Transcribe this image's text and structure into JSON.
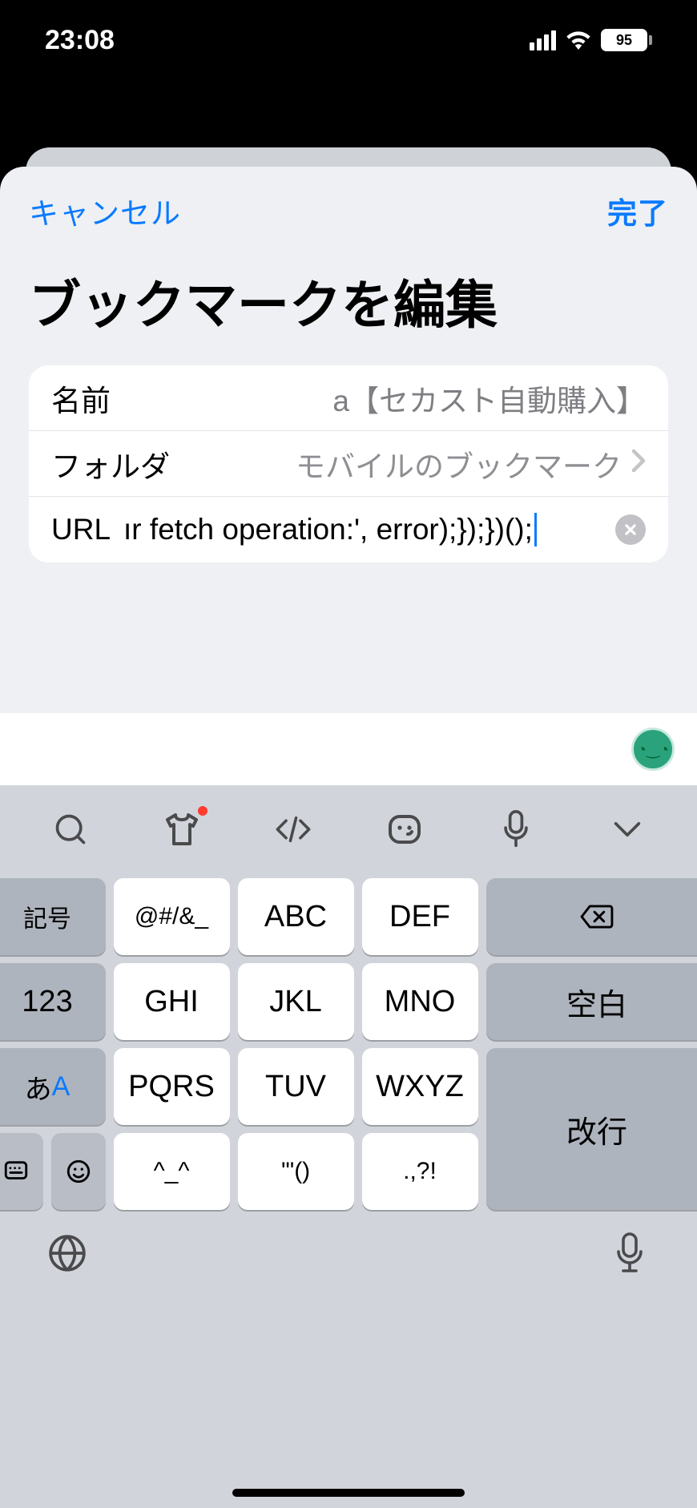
{
  "status": {
    "time": "23:08",
    "battery": "95"
  },
  "nav": {
    "cancel": "キャンセル",
    "done": "完了"
  },
  "title": "ブックマークを編集",
  "form": {
    "name_label": "名前",
    "name_value": "a【セカスト自動購入】",
    "folder_label": "フォルダ",
    "folder_value": "モバイルのブックマーク",
    "url_label": "URL",
    "url_value": "ır fetch operation:', error);});})();"
  },
  "keyboard": {
    "rows": {
      "r1": {
        "func": "記号",
        "k1": "@#/&_",
        "k2": "ABC",
        "k3": "DEF"
      },
      "r2": {
        "func": "123",
        "k1": "GHI",
        "k2": "JKL",
        "k3": "MNO",
        "space": "空白"
      },
      "r3": {
        "func_ja": "あ",
        "func_en": "A",
        "k1": "PQRS",
        "k2": "TUV",
        "k3": "WXYZ"
      },
      "r4": {
        "k1": "^_^",
        "k2": "'\"()",
        "k3": ".,?!",
        "enter": "改行"
      }
    }
  }
}
